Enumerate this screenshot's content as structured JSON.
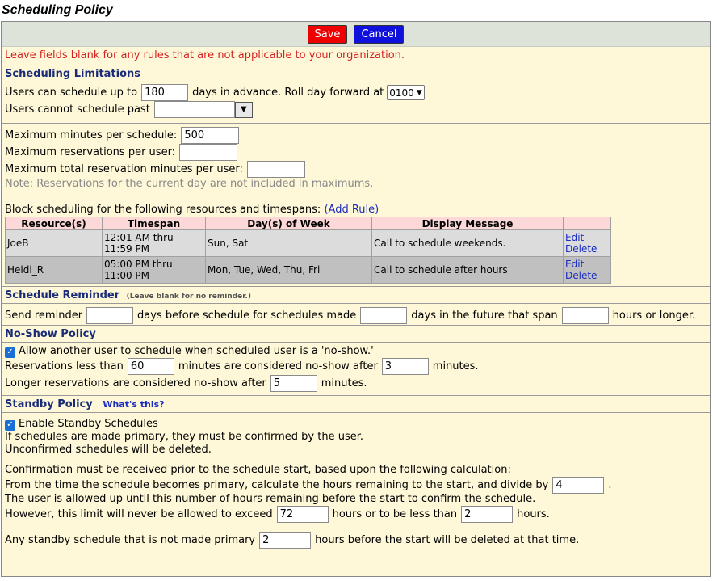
{
  "page_title": "Scheduling Policy",
  "toolbar": {
    "save_label": "Save",
    "cancel_label": "Cancel"
  },
  "notice": "Leave fields blank for any rules that are not applicable to your organization.",
  "limitations": {
    "header": "Scheduling Limitations",
    "advance_prefix": "Users can schedule up to",
    "advance_value": "180",
    "advance_suffix": "days in advance. Roll day forward at",
    "roll_value": "0100",
    "past_label": "Users cannot schedule past",
    "past_value": "",
    "max_minutes_label": "Maximum minutes per schedule:",
    "max_minutes_value": "500",
    "max_res_label": "Maximum reservations per user:",
    "max_res_value": "",
    "max_total_label": "Maximum total reservation minutes per user:",
    "max_total_value": "",
    "note": "Note: Reservations for the current day are not included in maximums.",
    "block_label": "Block scheduling for the following resources and timespans:",
    "add_rule": "(Add Rule)",
    "table": {
      "headers": [
        "Resource(s)",
        "Timespan",
        "Day(s) of Week",
        "Display Message",
        ""
      ],
      "rows": [
        {
          "resource": "JoeB",
          "time1": "12:01 AM thru",
          "time2": "11:59 PM",
          "days": "Sun, Sat",
          "message": "Call to schedule weekends.",
          "edit": "Edit",
          "delete": "Delete"
        },
        {
          "resource": "Heidi_R",
          "time1": "05:00 PM thru",
          "time2": "11:00 PM",
          "days": "Mon, Tue, Wed, Thu, Fri",
          "message": "Call to schedule after hours",
          "edit": "Edit",
          "delete": "Delete"
        }
      ]
    }
  },
  "reminder": {
    "header": "Schedule Reminder",
    "header_note": "(Leave blank for no reminder.)",
    "t1": "Send reminder",
    "v1": "",
    "t2": "days before schedule for schedules made",
    "v2": "",
    "t3": "days in the future that span",
    "v3": "",
    "t4": "hours or longer."
  },
  "noshow": {
    "header": "No-Show Policy",
    "allow_label": "Allow another user to schedule when scheduled user is a 'no-show.'",
    "less_prefix": "Reservations less than",
    "less_value": "60",
    "less_mid": "minutes are considered no-show after",
    "less_after": "3",
    "less_suffix": "minutes.",
    "longer_prefix": "Longer reservations are considered no-show after",
    "longer_value": "5",
    "longer_suffix": "minutes."
  },
  "standby": {
    "header": "Standby Policy",
    "whats_this": "What's this?",
    "enable_label": "Enable Standby Schedules",
    "line1": "If schedules are made primary, they must be confirmed by the user.",
    "line2": "Unconfirmed schedules will be deleted.",
    "line3": "Confirmation must be received prior to the schedule start, based upon the following calculation:",
    "line4_prefix": "From the time the schedule becomes primary, calculate the hours remaining to the start, and divide by",
    "divide_value": "4",
    "line4_suffix": ".",
    "line5": "The user is allowed up until this number of hours remaining before the start to confirm the schedule.",
    "exceed_prefix": "However, this limit will never be allowed to exceed",
    "exceed_value": "72",
    "exceed_mid": "hours or to be less than",
    "min_value": "2",
    "exceed_suffix": "hours.",
    "delete_prefix": "Any standby schedule that is not made primary",
    "delete_value": "2",
    "delete_suffix": "hours before the start will be deleted at that time."
  }
}
